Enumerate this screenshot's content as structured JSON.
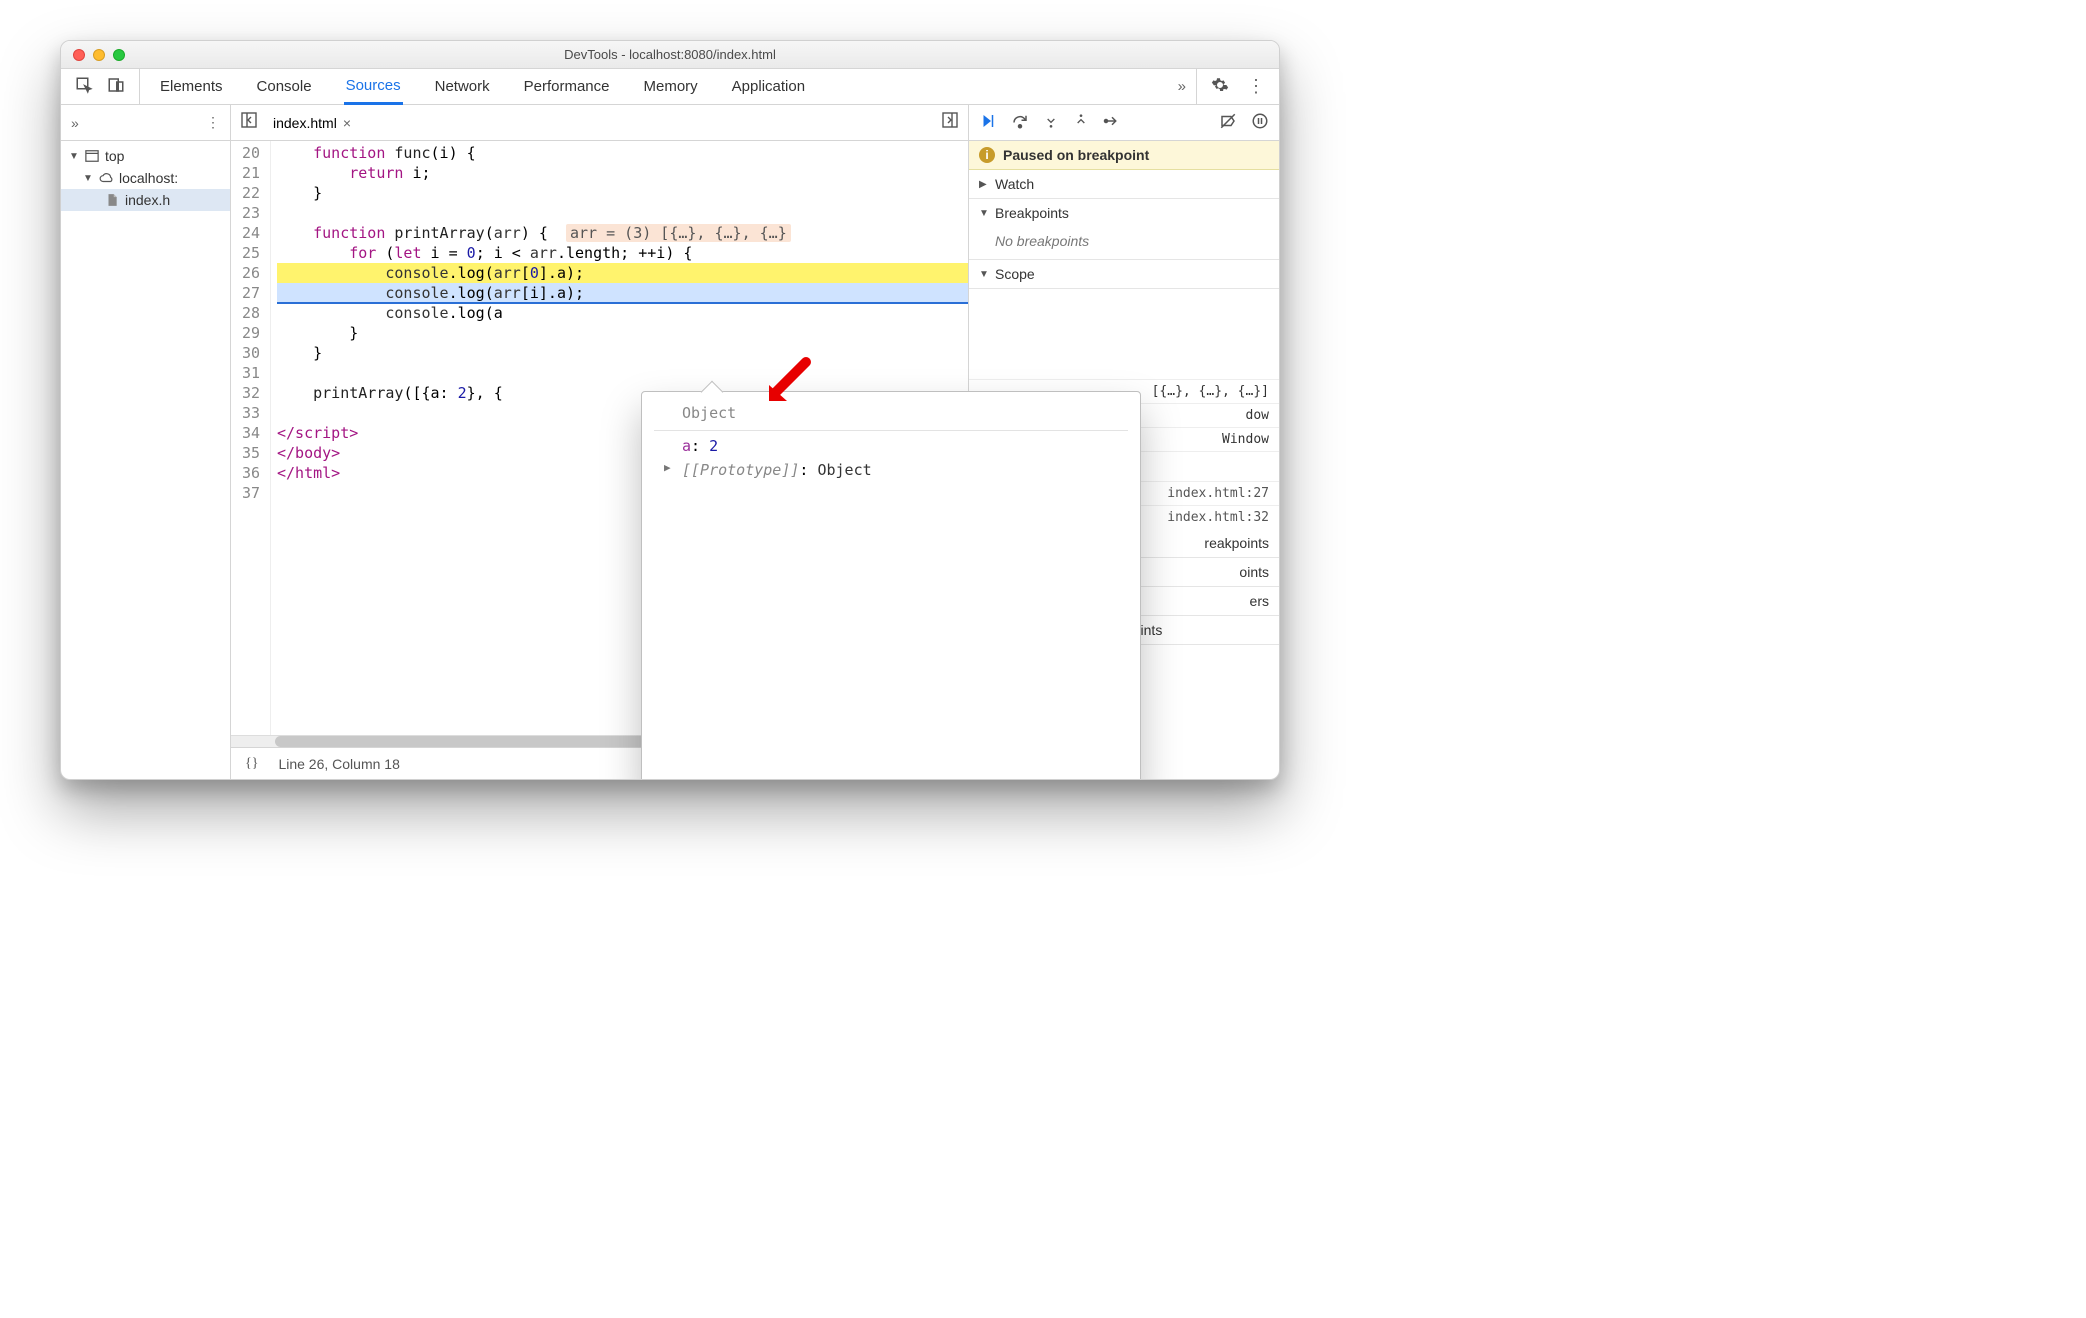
{
  "window": {
    "title": "DevTools - localhost:8080/index.html"
  },
  "tabs": {
    "list": [
      "Elements",
      "Console",
      "Sources",
      "Network",
      "Performance",
      "Memory",
      "Application"
    ],
    "active": "Sources"
  },
  "sidebar": {
    "tree": {
      "root_label": "top",
      "origin_label": "localhost:",
      "file_label": "index.h"
    }
  },
  "editor": {
    "open_file": "index.html",
    "first_line": 20,
    "lines": [
      {
        "n": 20,
        "tokens": [
          [
            "    ",
            ""
          ],
          [
            "function",
            "kw"
          ],
          [
            " ",
            ""
          ],
          [
            "func",
            "fn"
          ],
          [
            "(i) {",
            ""
          ]
        ]
      },
      {
        "n": 21,
        "tokens": [
          [
            "        ",
            ""
          ],
          [
            "return",
            "kw"
          ],
          [
            " i;",
            ""
          ]
        ]
      },
      {
        "n": 22,
        "tokens": [
          [
            "    }",
            ""
          ]
        ]
      },
      {
        "n": 23,
        "tokens": [
          [
            "",
            ""
          ]
        ]
      },
      {
        "n": 24,
        "tokens": [
          [
            "    ",
            ""
          ],
          [
            "function",
            "kw"
          ],
          [
            " ",
            ""
          ],
          [
            "printArray",
            "fn"
          ],
          [
            "(",
            ""
          ],
          [
            "arr",
            "id"
          ],
          [
            ") {  ",
            ""
          ]
        ],
        "hint": "arr = (3) [{…}, {…}, {…}"
      },
      {
        "n": 25,
        "tokens": [
          [
            "        ",
            ""
          ],
          [
            "for",
            "kw"
          ],
          [
            " (",
            ""
          ],
          [
            "let",
            "kw"
          ],
          [
            " i = ",
            ""
          ],
          [
            "0",
            "num"
          ],
          [
            "; i < ",
            ""
          ],
          [
            "arr",
            "id"
          ],
          [
            ".length; ++i) {",
            ""
          ]
        ]
      },
      {
        "n": 26,
        "hl": "yellow",
        "tokens": [
          [
            "            ",
            ""
          ],
          [
            "console",
            "id"
          ],
          [
            ".log(",
            ""
          ],
          [
            "arr",
            "id"
          ],
          [
            "[",
            ""
          ],
          [
            "0",
            "num"
          ],
          [
            "].a);",
            ""
          ]
        ]
      },
      {
        "n": 27,
        "hl": "blue",
        "tokens": [
          [
            "            ",
            ""
          ],
          [
            "console",
            "id"
          ],
          [
            ".log(",
            ""
          ],
          [
            "arr",
            "id"
          ],
          [
            "[i].a);",
            ""
          ]
        ]
      },
      {
        "n": 28,
        "tokens": [
          [
            "            ",
            ""
          ],
          [
            "console",
            "id"
          ],
          [
            ".log(a",
            ""
          ]
        ]
      },
      {
        "n": 29,
        "tokens": [
          [
            "        }",
            ""
          ]
        ]
      },
      {
        "n": 30,
        "tokens": [
          [
            "    }",
            ""
          ]
        ]
      },
      {
        "n": 31,
        "tokens": [
          [
            "",
            ""
          ]
        ]
      },
      {
        "n": 32,
        "tokens": [
          [
            "    ",
            ""
          ],
          [
            "printArray",
            "fn"
          ],
          [
            "([{a: ",
            ""
          ],
          [
            "2",
            "num"
          ],
          [
            "}, {",
            ""
          ]
        ]
      },
      {
        "n": 33,
        "tokens": [
          [
            "",
            ""
          ]
        ]
      },
      {
        "n": 34,
        "tokens": [
          [
            "</script",
            ""
          ],
          [
            ">",
            ""
          ]
        ],
        "style": "tag"
      },
      {
        "n": 35,
        "tokens": [
          [
            "</body>",
            ""
          ]
        ],
        "style": "tag"
      },
      {
        "n": 36,
        "tokens": [
          [
            "</html>",
            ""
          ]
        ],
        "style": "tag"
      },
      {
        "n": 37,
        "tokens": [
          [
            "",
            ""
          ]
        ]
      }
    ],
    "status": {
      "braces": "{}",
      "pos": "Line 26, Column 18"
    }
  },
  "debugger": {
    "banner": "Paused on breakpoint",
    "sections": {
      "watch": {
        "label": "Watch"
      },
      "breakpoints": {
        "label": "Breakpoints",
        "empty": "No breakpoints"
      },
      "scope": {
        "label": "Scope"
      }
    },
    "scope_peek": {
      "arr_summary": "[{…}, {…}, {…}]",
      "window_label": "dow",
      "global": "Window"
    },
    "callstack": [
      {
        "loc": "index.html:27"
      },
      {
        "loc": "index.html:32"
      }
    ],
    "hidden_sections": [
      "reakpoints",
      "oints",
      "ers",
      "Event Listener Breakpoints"
    ]
  },
  "popover": {
    "title": "Object",
    "prop_key": "a",
    "prop_val": "2",
    "proto_label": "[[Prototype]]",
    "proto_val": "Object"
  }
}
